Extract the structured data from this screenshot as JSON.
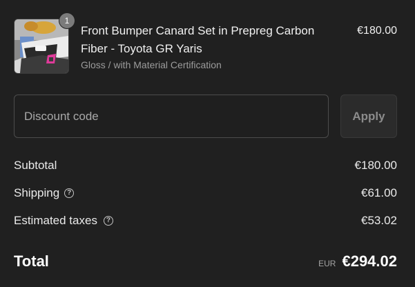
{
  "line_item": {
    "quantity": "1",
    "title": "Front Bumper Canard Set in Prepreg Carbon Fiber - Toyota GR Yaris",
    "variant": "Gloss / with Material Certification",
    "price": "€180.00",
    "thumbnail_icon": "product-photo-thumbnail"
  },
  "discount": {
    "placeholder": "Discount code",
    "value": "",
    "apply_label": "Apply"
  },
  "summary": {
    "subtotal_label": "Subtotal",
    "subtotal_value": "€180.00",
    "shipping_label": "Shipping",
    "shipping_value": "€61.00",
    "taxes_label": "Estimated taxes",
    "taxes_value": "€53.02",
    "help_icon": "question-circle-icon"
  },
  "total": {
    "label": "Total",
    "currency": "EUR",
    "value": "€294.02"
  },
  "colors": {
    "background": "#202020",
    "text": "#e9e9e9",
    "muted": "#9c9c9c",
    "badge": "#7b7b7b"
  }
}
